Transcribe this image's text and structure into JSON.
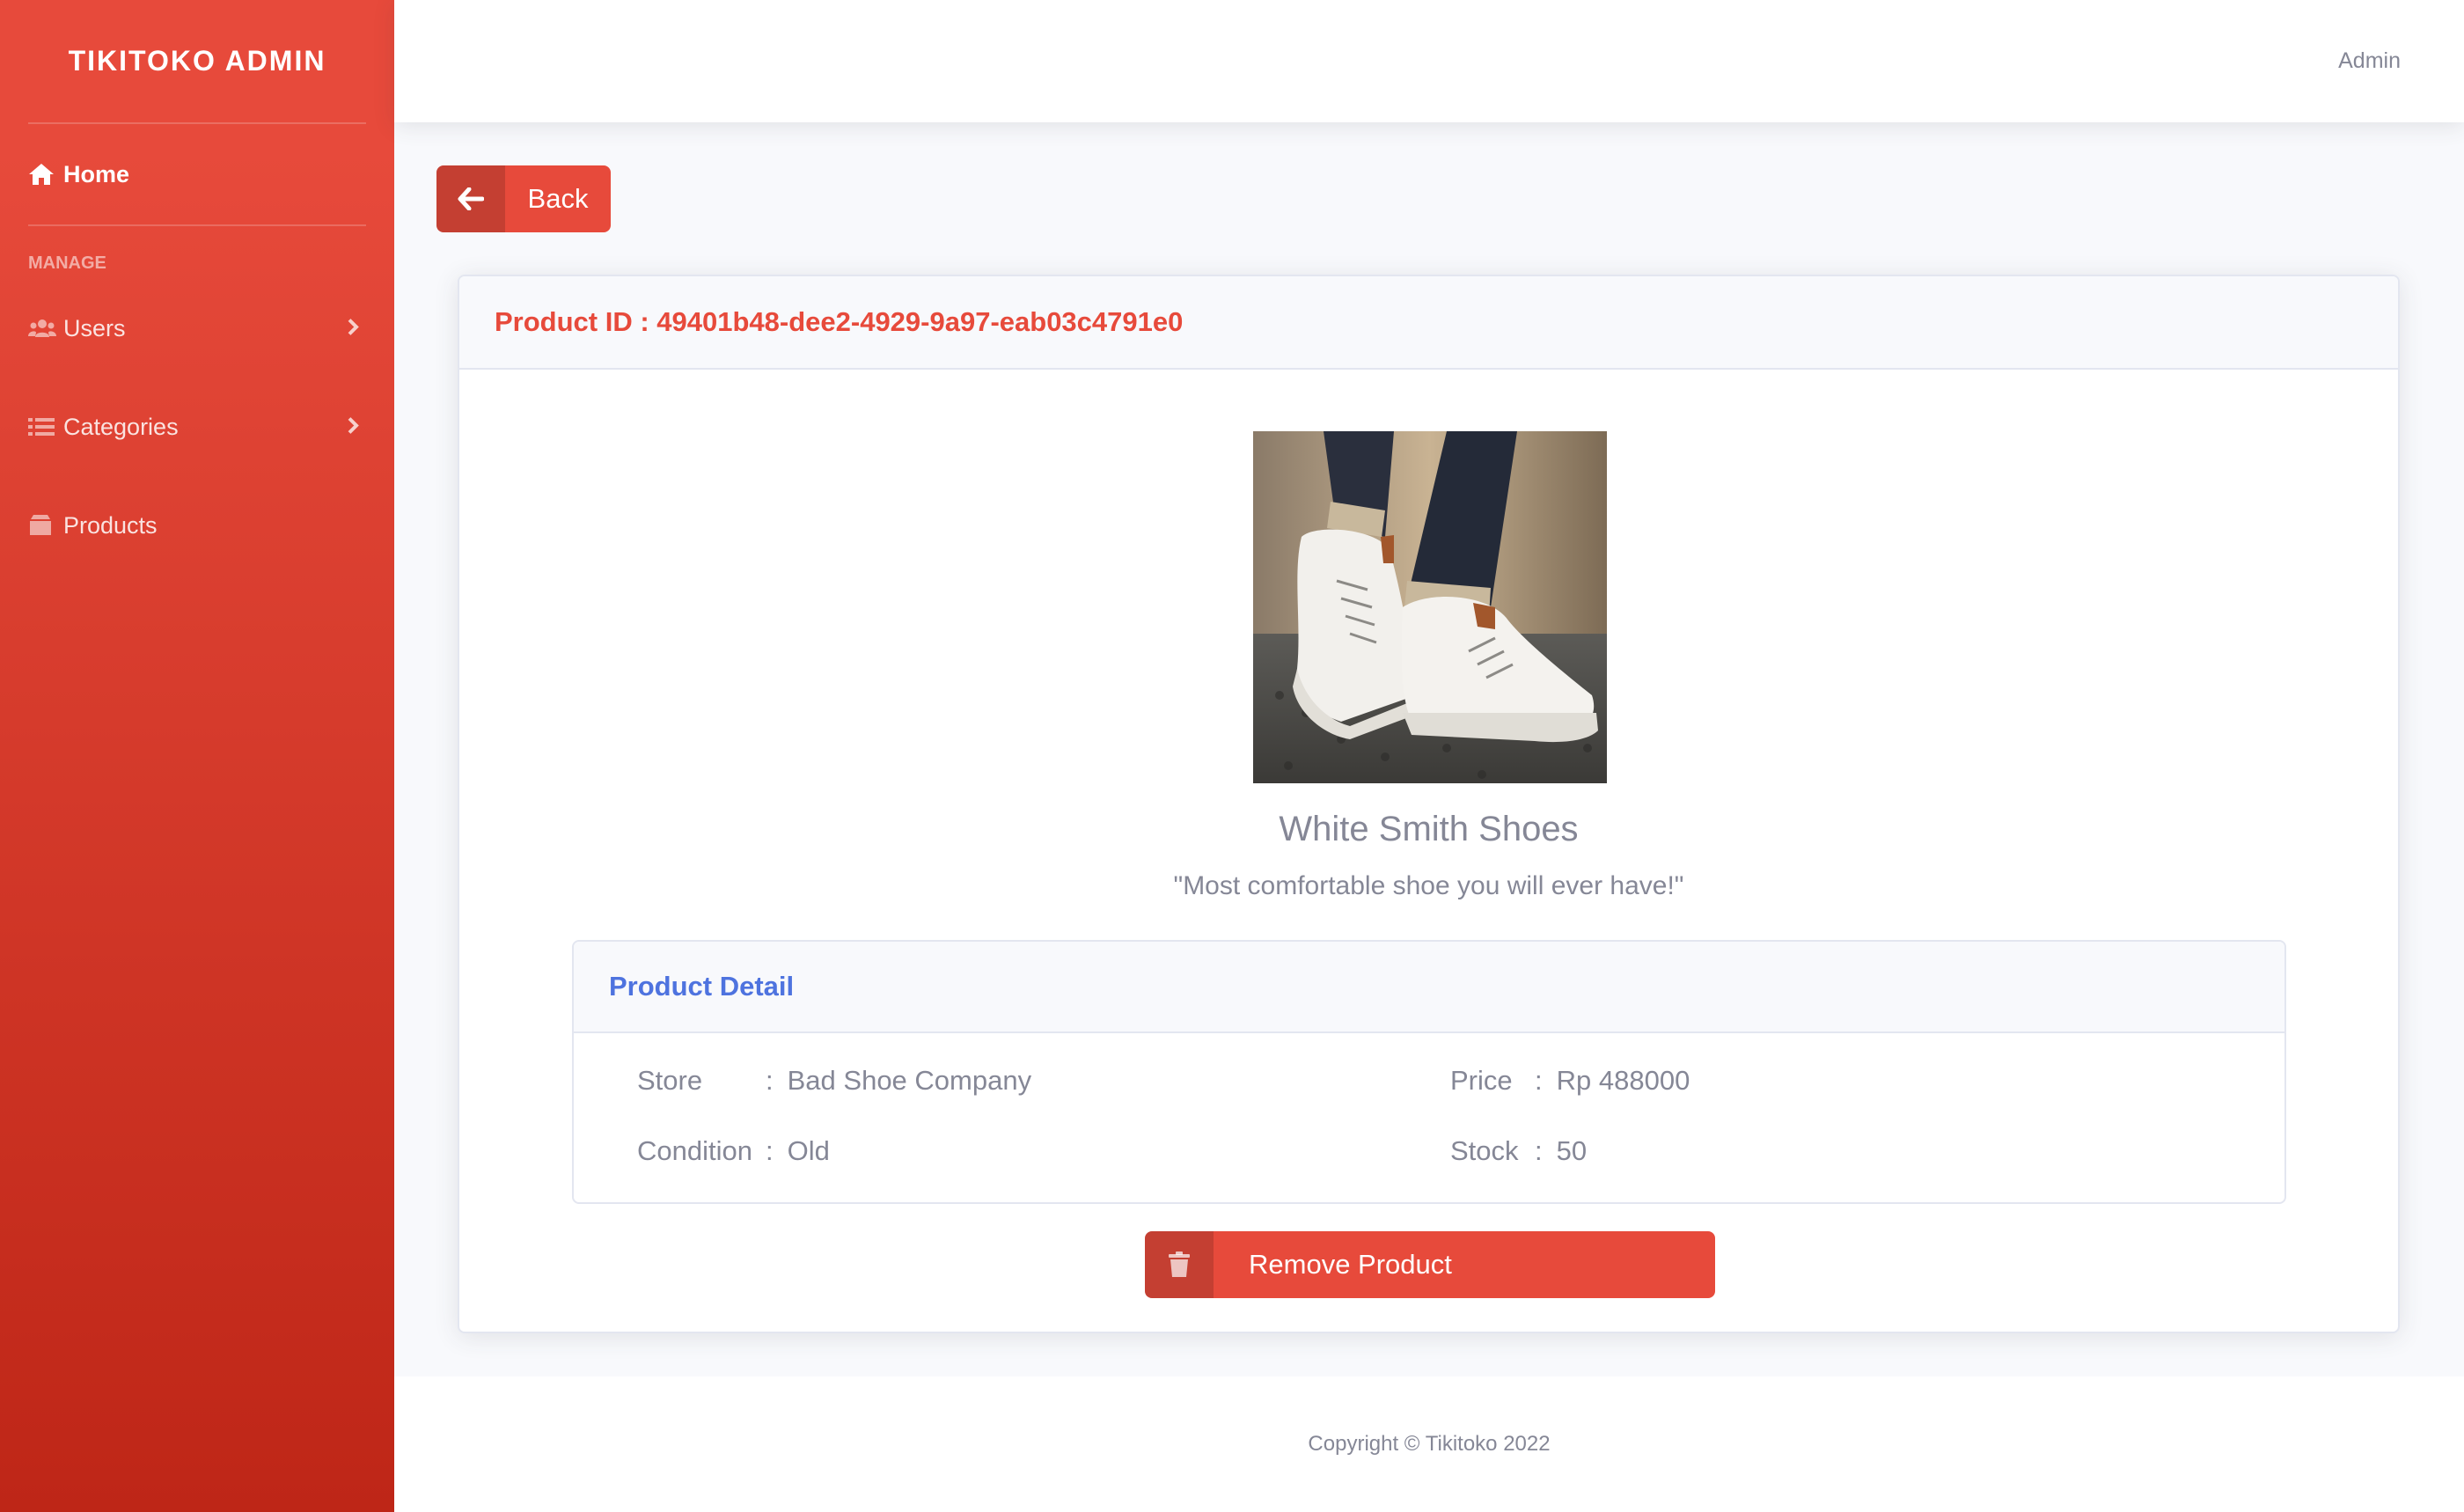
{
  "sidebar": {
    "brand": "TIKITOKO ADMIN",
    "home": {
      "label": "Home",
      "icon": "home-icon"
    },
    "heading": "MANAGE",
    "items": [
      {
        "label": "Users",
        "icon": "users-icon",
        "has_submenu": true
      },
      {
        "label": "Categories",
        "icon": "list-icon",
        "has_submenu": true
      },
      {
        "label": "Products",
        "icon": "box-icon",
        "has_submenu": false
      }
    ]
  },
  "topbar": {
    "user": "Admin"
  },
  "back_button": {
    "label": "Back",
    "icon": "arrow-left-icon"
  },
  "product": {
    "id_label": "Product ID : 49401b48-dee2-4929-9a97-eab03c4791e0",
    "name": "White Smith Shoes",
    "description": "\"Most comfortable shoe you will ever have!\"",
    "detail_title": "Product Detail",
    "fields": {
      "store": {
        "label": "Store",
        "value": "Bad Shoe Company"
      },
      "condition": {
        "label": "Condition",
        "value": "Old"
      },
      "price": {
        "label": "Price",
        "value": "Rp 488000"
      },
      "stock": {
        "label": "Stock",
        "value": "50"
      }
    },
    "separator": ":"
  },
  "remove_button": {
    "label": "Remove Product",
    "icon": "trash-icon"
  },
  "footer": {
    "copyright": "Copyright © Tikitoko 2022"
  },
  "colors": {
    "primary": "#e74a3b",
    "primary_dark": "#be2617",
    "accent_blue": "#4e73df",
    "text_muted": "#858796"
  }
}
